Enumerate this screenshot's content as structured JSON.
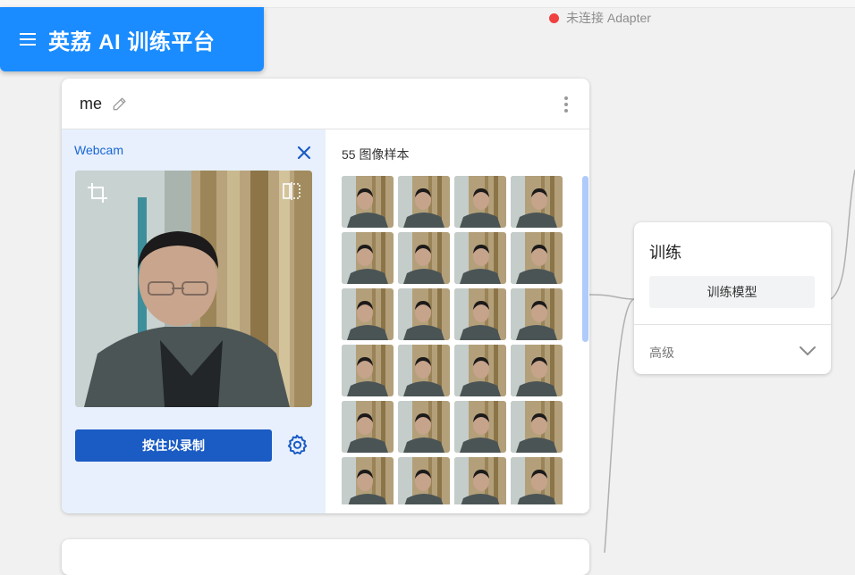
{
  "app": {
    "title": "英荔 AI 训练平台",
    "brand_color": "#1a8cff",
    "menu_icon": "menu-icon"
  },
  "status": {
    "text": "未连接 Adapter",
    "dot_color": "#f04040"
  },
  "class_card": {
    "name": "me",
    "edit_icon": "pencil-icon",
    "more_icon": "more-vertical-icon",
    "input": {
      "label": "Webcam",
      "close_icon": "close-icon",
      "crop_icon": "crop-icon",
      "flip_icon": "flip-icon",
      "record_label": "按住以录制",
      "settings_icon": "gear-icon",
      "accent": "#1a5bc4"
    },
    "samples": {
      "count_label": "55 图像样本",
      "thumbnail_count": 24
    }
  },
  "train_card": {
    "title": "训练",
    "button_label": "训练模型",
    "advanced_label": "高级",
    "expand_icon": "chevron-down-icon"
  }
}
